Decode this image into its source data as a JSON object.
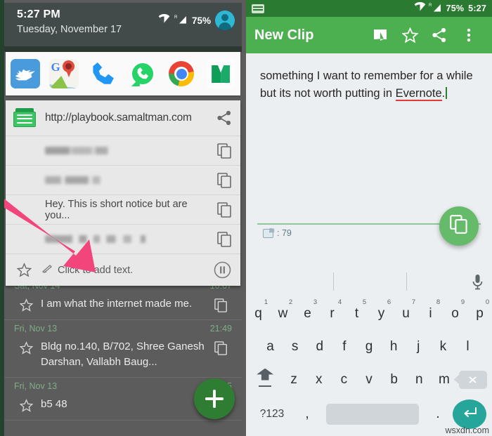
{
  "left_phone": {
    "quick_settings": {
      "time": "5:27 PM",
      "date": "Tuesday, November 17",
      "battery": "75%",
      "wifi_icon": "wifi-icon",
      "signal_icon": "signal-roaming-icon",
      "avatar_icon": "user-avatar-icon"
    },
    "app_shortcuts": [
      {
        "name": "twitter",
        "label": "Twitter"
      },
      {
        "name": "google-maps",
        "label": "Maps"
      },
      {
        "name": "phone",
        "label": "Phone"
      },
      {
        "name": "whatsapp",
        "label": "WhatsApp"
      },
      {
        "name": "chrome",
        "label": "Chrome"
      },
      {
        "name": "hangouts",
        "label": "Hangouts"
      }
    ],
    "notification": {
      "app_icon": "clipboard-icon",
      "url": "http://playbook.samaltman.com",
      "share_icon": "share-icon",
      "rows": [
        {
          "text": "",
          "blurred": true,
          "copy_icon": "copy-icon"
        },
        {
          "text": "",
          "blurred": true,
          "copy_icon": "copy-icon"
        },
        {
          "text": "Hey. This is short notice but are you...",
          "blurred": false,
          "copy_icon": "copy-icon"
        },
        {
          "text": "",
          "blurred": true,
          "copy_icon": "copy-icon"
        }
      ],
      "add_text_label": "Click to add text.",
      "star_icon": "star-icon",
      "pencil_icon": "pencil-icon",
      "pause_icon": "pause-button-icon"
    },
    "background_list": {
      "groups": [
        {
          "date": "Sat, Nov 14",
          "time": "10:07",
          "items": [
            {
              "text": "I am what the internet made me.",
              "star_icon": "star-icon",
              "copy_icon": "copy-icon"
            }
          ]
        },
        {
          "date": "Fri, Nov 13",
          "time": "21:49",
          "items": [
            {
              "text": "Bldg no.140, B/702, Shree Ganesh Darshan, Vallabh Baug...",
              "star_icon": "star-icon",
              "copy_icon": "copy-icon"
            }
          ]
        },
        {
          "date": "Fri, Nov 13",
          "time": "5",
          "items": [
            {
              "text": "b5 48",
              "star_icon": "star-icon",
              "copy_icon": "copy-icon"
            }
          ]
        }
      ]
    },
    "fab": {
      "icon": "plus-icon",
      "label": "+",
      "color": "#2f7d32"
    },
    "annotation_arrow": {
      "icon": "pink-arrow-icon",
      "color": "#F2457C"
    }
  },
  "right_phone": {
    "status_bar": {
      "keyboard_icon": "keyboard-icon",
      "wifi_icon": "wifi-icon",
      "signal_icon": "signal-roaming-icon",
      "battery": "75%",
      "time": "5:27"
    },
    "toolbar": {
      "title": "New Clip",
      "book_icon": "book-icon",
      "star_icon": "star-icon",
      "share_icon": "share-icon",
      "overflow_icon": "overflow-menu-icon",
      "color": "#4caf50"
    },
    "editor": {
      "text_part1": "something I want to remember for a while but its not worth putting in ",
      "misspelled_word": "Evernote",
      "text_part2": ".",
      "char_count_label": ": 79",
      "count_icon": "clip-count-icon"
    },
    "fab": {
      "icon": "copy-icon",
      "color": "#66bb6a"
    },
    "annotation_arrow": {
      "icon": "pink-arrow-icon",
      "color": "#F2457C"
    },
    "keyboard": {
      "suggestion_bar": {
        "mic_icon": "microphone-icon",
        "suggestions": [
          "",
          "",
          ""
        ]
      },
      "row1": [
        {
          "key": "q",
          "num": "1"
        },
        {
          "key": "w",
          "num": "2"
        },
        {
          "key": "e",
          "num": "3"
        },
        {
          "key": "r",
          "num": "4"
        },
        {
          "key": "t",
          "num": "5"
        },
        {
          "key": "y",
          "num": "6"
        },
        {
          "key": "u",
          "num": "7"
        },
        {
          "key": "i",
          "num": "8"
        },
        {
          "key": "o",
          "num": "9"
        },
        {
          "key": "p",
          "num": "0"
        }
      ],
      "row2": [
        "a",
        "s",
        "d",
        "f",
        "g",
        "h",
        "j",
        "k",
        "l"
      ],
      "row3": [
        "z",
        "x",
        "c",
        "v",
        "b",
        "n",
        "m"
      ],
      "shift_icon": "shift-key-icon",
      "backspace_icon": "backspace-key-icon",
      "symbols_key": "?123",
      "comma_key": ",",
      "space_key": "",
      "period_key": ".",
      "enter_icon": "enter-key-icon"
    }
  },
  "watermark": "wsxdn.com"
}
